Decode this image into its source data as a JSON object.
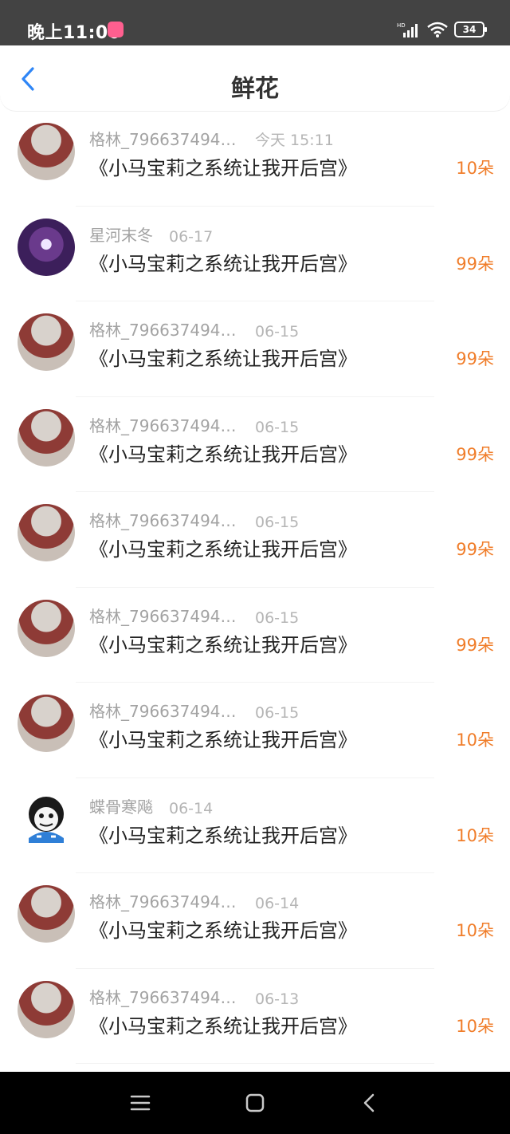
{
  "status_bar": {
    "time": "晚上11:00",
    "battery": "34",
    "app_badge": "App"
  },
  "header": {
    "title": "鲜花"
  },
  "records": [
    {
      "username": "格林_7966374947...",
      "date": "今天 15:11",
      "book": "《小马宝莉之系统让我开后宫》",
      "count": "10朵",
      "avatar": "red"
    },
    {
      "username": "星河末冬",
      "date": "06-17",
      "book": "《小马宝莉之系统让我开后宫》",
      "count": "99朵",
      "avatar": "purple"
    },
    {
      "username": "格林_7966374947...",
      "date": "06-15",
      "book": "《小马宝莉之系统让我开后宫》",
      "count": "99朵",
      "avatar": "red"
    },
    {
      "username": "格林_7966374947...",
      "date": "06-15",
      "book": "《小马宝莉之系统让我开后宫》",
      "count": "99朵",
      "avatar": "red"
    },
    {
      "username": "格林_7966374947...",
      "date": "06-15",
      "book": "《小马宝莉之系统让我开后宫》",
      "count": "99朵",
      "avatar": "red"
    },
    {
      "username": "格林_7966374947...",
      "date": "06-15",
      "book": "《小马宝莉之系统让我开后宫》",
      "count": "99朵",
      "avatar": "red"
    },
    {
      "username": "格林_7966374947...",
      "date": "06-15",
      "book": "《小马宝莉之系统让我开后宫》",
      "count": "10朵",
      "avatar": "red"
    },
    {
      "username": "蝶骨寒飚",
      "date": "06-14",
      "book": "《小马宝莉之系统让我开后宫》",
      "count": "10朵",
      "avatar": "skull"
    },
    {
      "username": "格林_7966374947...",
      "date": "06-14",
      "book": "《小马宝莉之系统让我开后宫》",
      "count": "10朵",
      "avatar": "red"
    },
    {
      "username": "格林_7966374947...",
      "date": "06-13",
      "book": "《小马宝莉之系统让我开后宫》",
      "count": "10朵",
      "avatar": "red"
    }
  ],
  "colors": {
    "accent": "#2f86f6",
    "count": "#f07d2a",
    "status_bar": "#434343"
  }
}
